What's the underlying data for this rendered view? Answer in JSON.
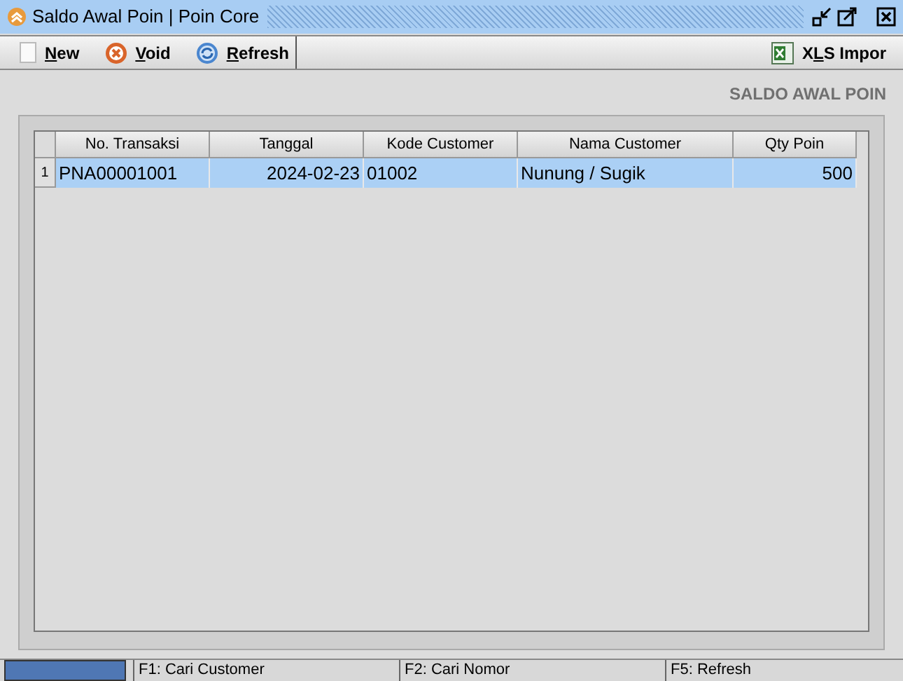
{
  "window": {
    "title": "Saldo Awal Poin | Poin Core"
  },
  "toolbar": {
    "left": [
      {
        "kind": "new",
        "key": "N",
        "after": "ew"
      },
      {
        "kind": "void",
        "key": "V",
        "after": "oid"
      },
      {
        "kind": "refresh",
        "key": "R",
        "after": "efresh"
      }
    ],
    "right": [
      {
        "kind": "xls",
        "before": "X",
        "key": "L",
        "after": "S Impor"
      }
    ]
  },
  "heading": "SALDO AWAL POIN",
  "table": {
    "columns": [
      {
        "label": "No. Transaksi"
      },
      {
        "label": "Tanggal"
      },
      {
        "label": "Kode Customer"
      },
      {
        "label": "Nama Customer"
      },
      {
        "label": "Qty Poin"
      }
    ],
    "rows": [
      {
        "number": "1",
        "selected": true,
        "cells": [
          "PNA00001001",
          "2024-02-23",
          "01002",
          "Nunung / Sugik",
          "500"
        ]
      }
    ]
  },
  "status_bar": [
    "F1: Cari Customer",
    "F2: Cari Nomor",
    "F5: Refresh"
  ]
}
